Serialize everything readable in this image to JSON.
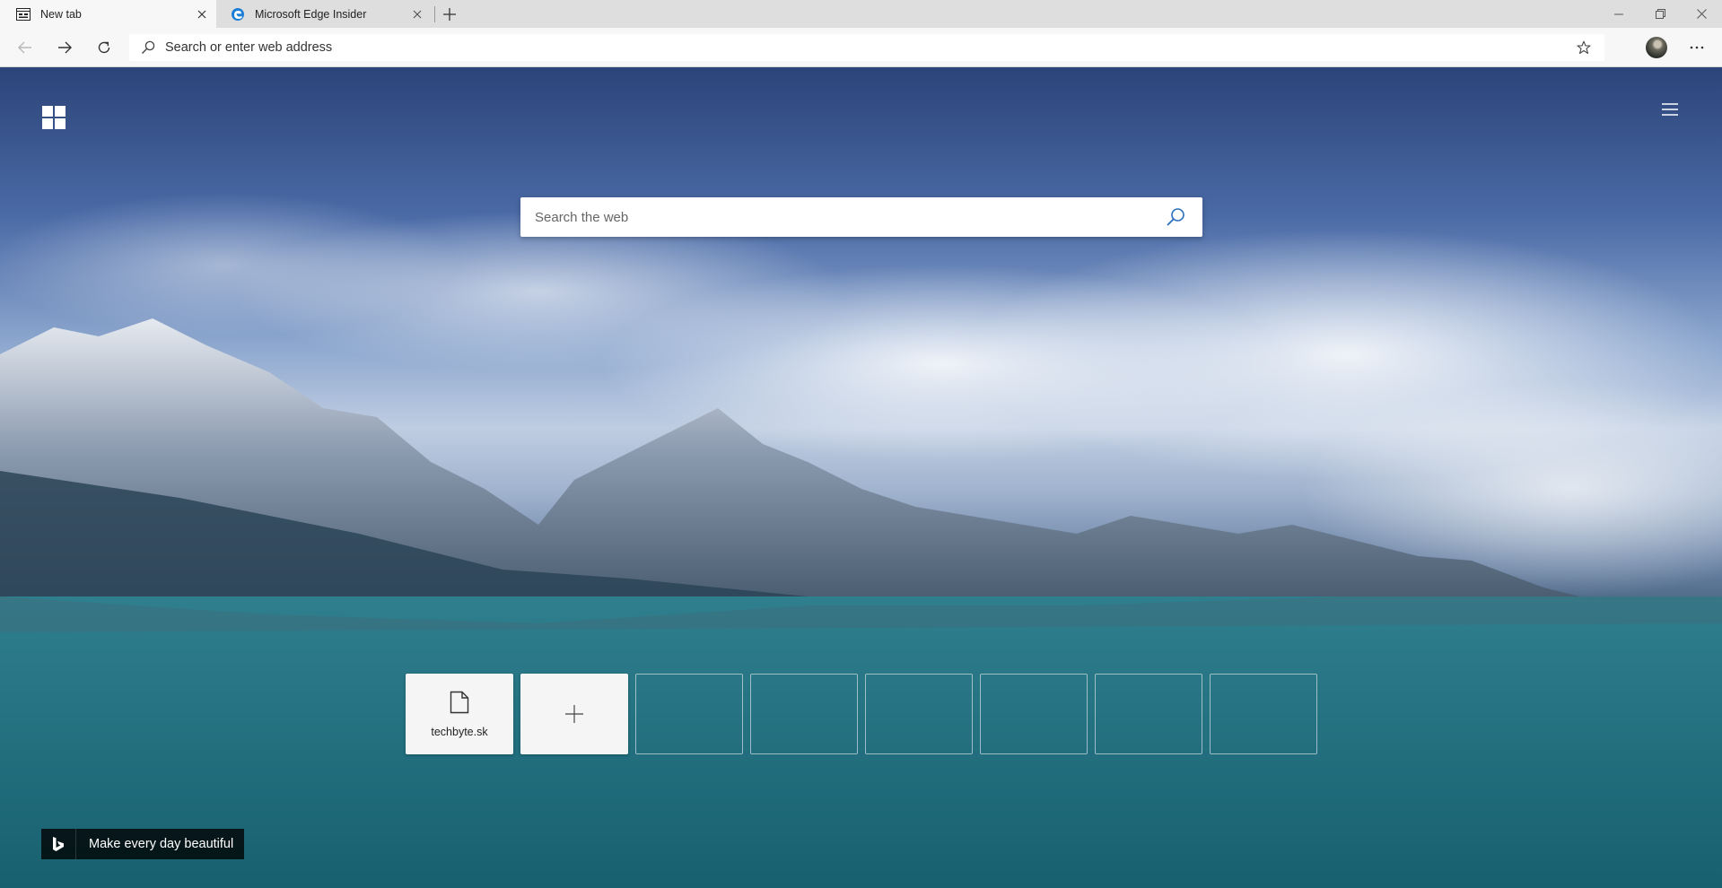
{
  "tabs": [
    {
      "title": "New tab",
      "icon": "new-tab-page-icon",
      "active": true
    },
    {
      "title": "Microsoft Edge Insider",
      "icon": "edge-logo-icon",
      "active": false
    }
  ],
  "address_bar": {
    "placeholder": "Search or enter web address"
  },
  "ntp": {
    "search": {
      "placeholder": "Search the web"
    },
    "top_sites": [
      {
        "label": "techbyte.sk",
        "icon": "document-icon"
      }
    ],
    "add_site": {
      "icon": "plus-icon"
    },
    "empty_slots": 6,
    "image_credit": {
      "text": "Make every day beautiful",
      "icon": "bing-logo-icon"
    }
  },
  "colors": {
    "tab_strip": "#dedede",
    "toolbar": "#f7f7f7",
    "search_icon": "#2a6fbd"
  }
}
